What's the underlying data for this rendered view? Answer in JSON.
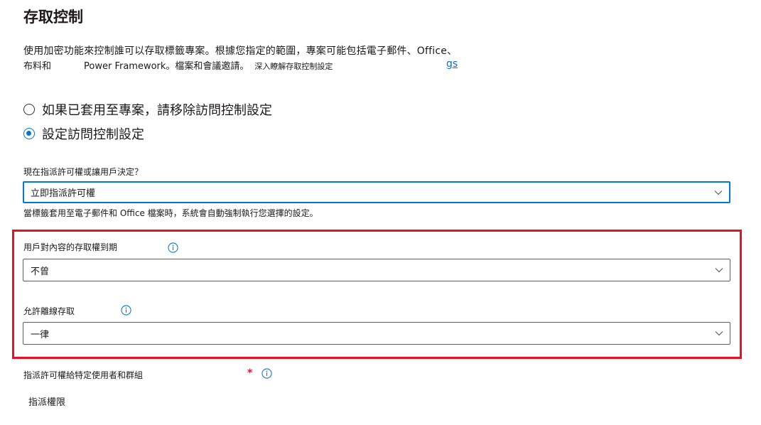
{
  "header": {
    "title": "存取控制"
  },
  "description": {
    "line1": "使用加密功能來控制誰可以存取標籤專案。根據您指定的範圍，專案可能包括電子郵件、Office、",
    "line2_part1": "布料和",
    "line2_part2": "Power Framework。檔案和會議邀請。",
    "learn_more": "深入瞭解存取控制設定",
    "link_fragment": "gs"
  },
  "access_options": {
    "options": [
      {
        "label": "如果已套用至專案，請移除訪問控制設定",
        "selected": false
      },
      {
        "label": "設定訪問控制設定",
        "selected": true
      }
    ]
  },
  "assign_now": {
    "label": "現在指派許可權或讓用戶決定？",
    "value": "立即指派許可權",
    "helper": "當標籤套用至電子郵件和 Office 檔案時，系統會自動強制執行您選擇的設定。"
  },
  "expiry": {
    "label": "用戶對內容的存取權到期",
    "value": "不曾"
  },
  "offline": {
    "label": "允許離線存取",
    "value": "一律"
  },
  "assign_users": {
    "label": "指派許可權給特定使用者和群組",
    "required_mark": "*",
    "button": "指派權限"
  },
  "colors": {
    "accent": "#0078d4",
    "highlight_box": "#e81123",
    "link": "#0f6cbd"
  }
}
